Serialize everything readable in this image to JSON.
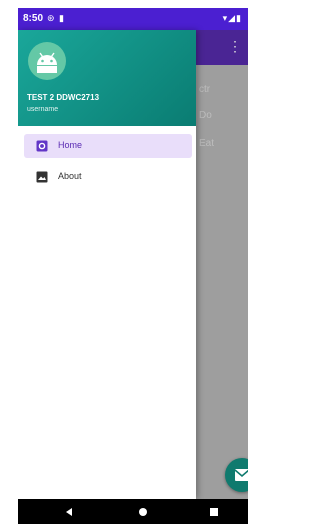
{
  "status_bar": {
    "time": "8:50"
  },
  "drawer": {
    "header": {
      "title": "TEST 2 DDWC2713",
      "subtitle": "username"
    },
    "items": [
      {
        "label": "Home",
        "icon": "home-icon",
        "active": true
      },
      {
        "label": "About",
        "icon": "image-icon",
        "active": false
      }
    ]
  },
  "colors": {
    "status_bar": "#4b1fd1",
    "toolbar": "#4a2594",
    "header": "#0f8f82",
    "active_item_bg": "#e9defa",
    "fab": "#0f7a6e"
  }
}
